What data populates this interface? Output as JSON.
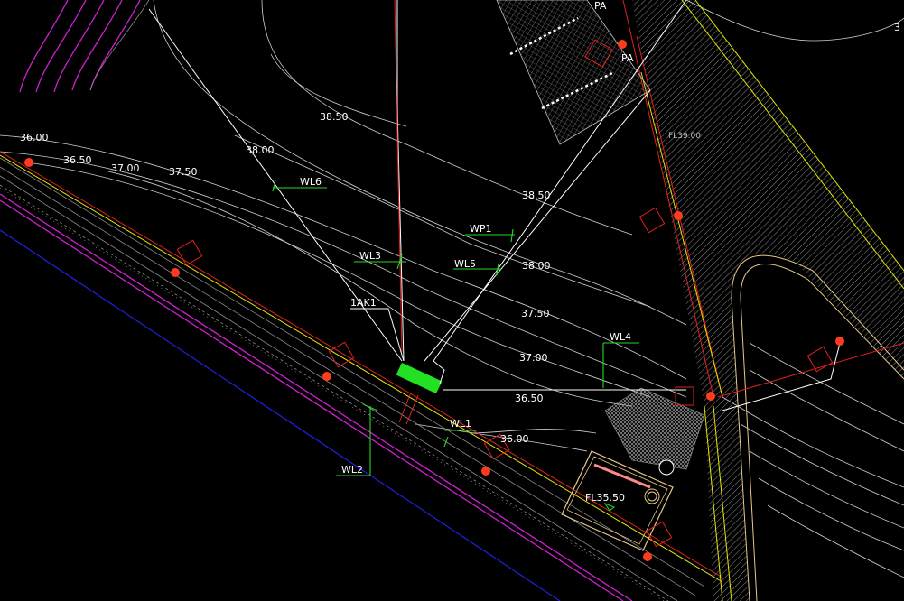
{
  "drawing": {
    "background": "#000000",
    "colors": {
      "contour": "#d0d0d0",
      "leader": "#26d926",
      "road_edge": "#e6e600",
      "boundary": "#e02020",
      "magenta": "#d020d0",
      "blue": "#2020e0",
      "hatch": "#8a8a8a",
      "lamp": "#ff3b1f",
      "device": "#22e022"
    },
    "contour_labels": {
      "c1": "36.00",
      "c2": "36.50",
      "c3": "37.00",
      "c4": "37.50",
      "c5": "38.00",
      "c6": "38.50",
      "c7": "38.50",
      "c8": "38.00",
      "c9": "37.50",
      "c10": "37.00",
      "c11": "36.50",
      "c12": "36.00"
    },
    "level_labels": {
      "fl_top": "FL39.00",
      "fl_bottom": "FL35.50"
    },
    "parking_labels": {
      "p1": "PA",
      "p2": "PA"
    },
    "corner_label": "3",
    "device_tags": {
      "wl1": "WL1",
      "wl2": "WL2",
      "wl3": "WL3",
      "wl4": "WL4",
      "wl5": "WL5",
      "wl6": "WL6",
      "wp1": "WP1",
      "ak1": "1AK1"
    }
  }
}
